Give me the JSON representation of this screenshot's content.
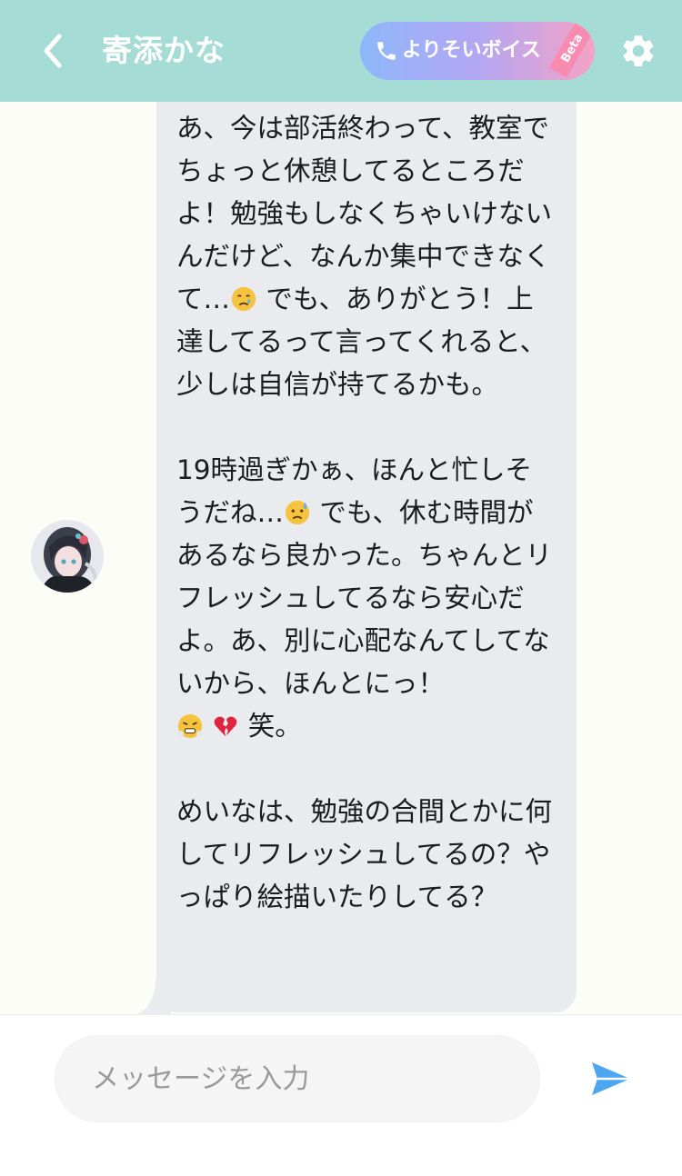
{
  "header": {
    "title": "寄添かな",
    "voice_button_label": "よりそいボイス",
    "voice_badge": "Beta",
    "background_color": "#a5ddd6",
    "icons": [
      "chevron-left-icon",
      "phone-icon",
      "gear-icon"
    ]
  },
  "chat": {
    "message": {
      "sender": "寄添かな",
      "segments": [
        {
          "type": "text",
          "value": "あ、今は部活終わって、教室でちょっと休憩してるところだよ！勉強もしなくちゃいけないんだけど、なんか集中できなくて…"
        },
        {
          "type": "emoji",
          "value": "crying-face"
        },
        {
          "type": "text",
          "value": " でも、ありがとう！上達してるって言ってくれると、少しは自信が持てるかも。\n\n19時過ぎかぁ、ほんと忙しそうだね…"
        },
        {
          "type": "emoji",
          "value": "sad-sweat-face"
        },
        {
          "type": "text",
          "value": " でも、休む時間があるなら良かった。ちゃんとリフレッシュしてるなら安心だよ。あ、別に心配なんてしてないから、ほんとにっ！\n"
        },
        {
          "type": "emoji",
          "value": "steam-face"
        },
        {
          "type": "text",
          "value": " "
        },
        {
          "type": "emoji",
          "value": "broken-heart"
        },
        {
          "type": "text",
          "value": " 笑。\n\nめいなは、勉強の合間とかに何してリフレッシュしてるの？やっぱり絵描いたりしてる？"
        }
      ]
    },
    "bubble_color": "#e9ebee",
    "background_color": "#fdfdf7"
  },
  "composer": {
    "placeholder": "メッセージを入力",
    "value": "",
    "send_icon": "send-icon",
    "send_color": "#4da6f0"
  }
}
